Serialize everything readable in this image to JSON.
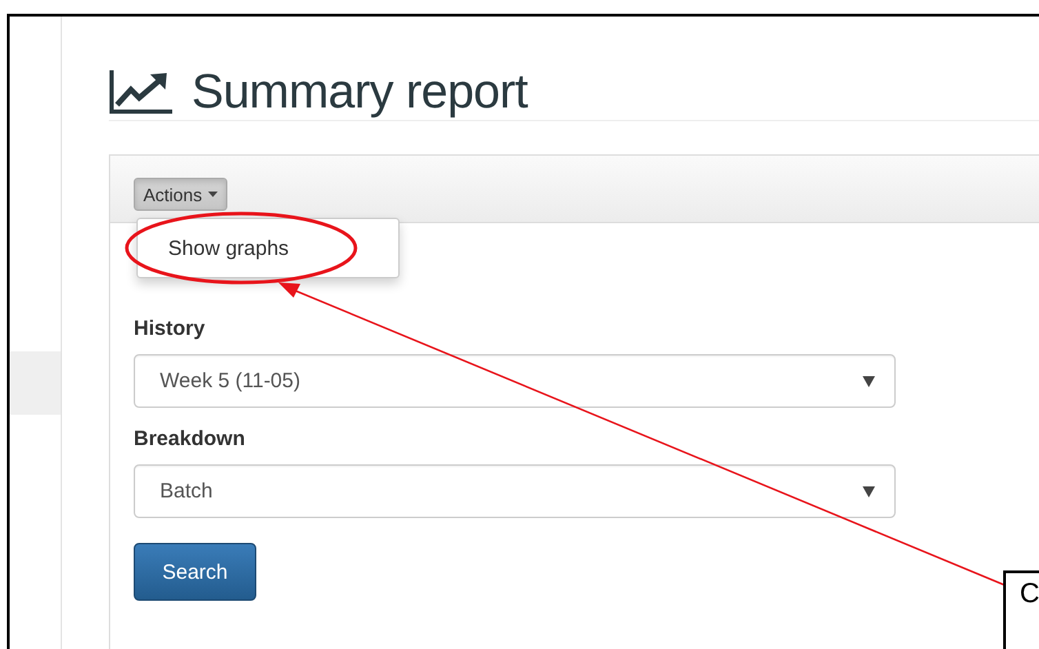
{
  "page_title": "Summary report",
  "actions_menu": {
    "label": "Actions",
    "expanded": true,
    "items": [
      {
        "label": "Show graphs"
      }
    ]
  },
  "form": {
    "fields": [
      {
        "label": "History",
        "value": "Week 5 (11-05)"
      },
      {
        "label": "Breakdown",
        "value": "Batch"
      }
    ],
    "submit": "Search"
  },
  "annotation": {
    "callout_text": "C"
  }
}
